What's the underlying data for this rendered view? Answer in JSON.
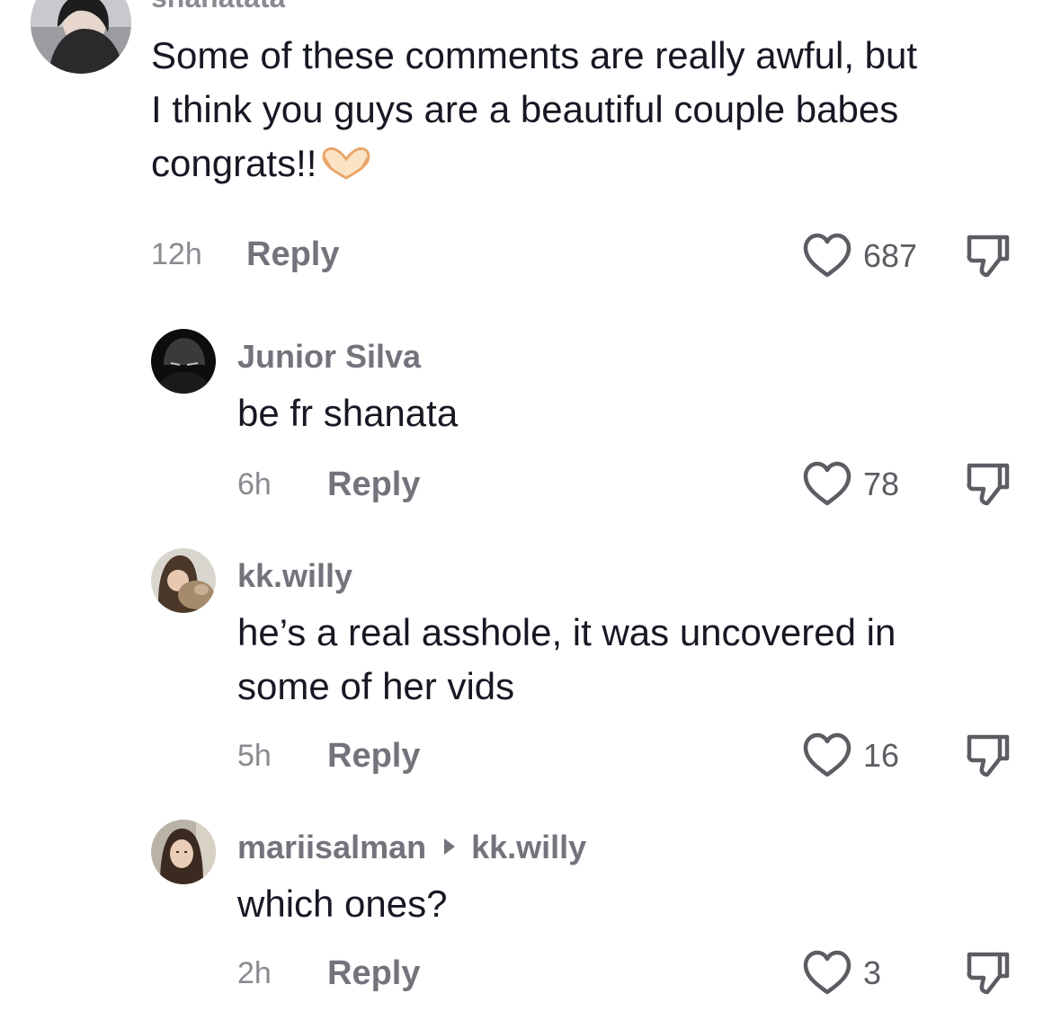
{
  "comments": [
    {
      "username": "shanatata",
      "text_lines": [
        "Some of these comments are really awful, but",
        "I think you guys are a beautiful couple babes",
        "congrats!!"
      ],
      "emoji": "heart-hands-emoji",
      "time": "12h",
      "reply_label": "Reply",
      "likes": "687"
    },
    {
      "username": "Junior Silva",
      "text_lines": [
        "be fr shanata"
      ],
      "time": "6h",
      "reply_label": "Reply",
      "likes": "78"
    },
    {
      "username": "kk.willy",
      "text_lines": [
        "he’s a real asshole, it was uncovered in",
        "some of her vids"
      ],
      "time": "5h",
      "reply_label": "Reply",
      "likes": "16"
    },
    {
      "username": "mariisalman",
      "reply_to": "kk.willy",
      "text_lines": [
        "which ones?"
      ],
      "time": "2h",
      "reply_label": "Reply",
      "likes": "3"
    }
  ],
  "colors": {
    "text": "#161823",
    "secondary": "#73747b",
    "muted": "#8a8b91"
  }
}
